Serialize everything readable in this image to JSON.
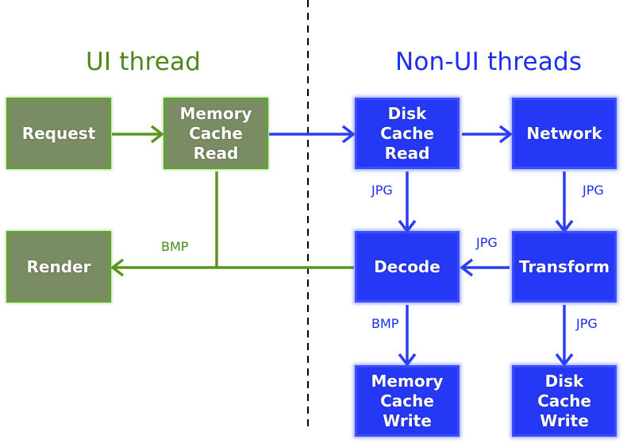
{
  "colors": {
    "ui_thread": "#4a8a1a",
    "non_ui_thread": "#1a2ff0",
    "green_box_fill": "#7a8c63",
    "blue_box_fill": "#2538f5",
    "divider": "#000000"
  },
  "sections": {
    "ui_thread": "UI thread",
    "non_ui_threads": "Non-UI threads"
  },
  "nodes": {
    "request": "Request",
    "memory_cache_read": "Memory\nCache\nRead",
    "render": "Render",
    "disk_cache_read": "Disk\nCache\nRead",
    "network": "Network",
    "decode": "Decode",
    "transform": "Transform",
    "memory_cache_write": "Memory\nCache\nWrite",
    "disk_cache_write": "Disk\nCache\nWrite"
  },
  "edge_labels": {
    "memory_read_to_render": "BMP",
    "disk_read_to_decode": "JPG",
    "network_to_transform": "JPG",
    "transform_to_decode": "JPG",
    "decode_to_memory_write": "BMP",
    "transform_to_disk_write": "JPG"
  },
  "edges": [
    {
      "from": "request",
      "to": "memory_cache_read",
      "color": "green"
    },
    {
      "from": "memory_cache_read",
      "to": "disk_cache_read",
      "color": "blue"
    },
    {
      "from": "disk_cache_read",
      "to": "network",
      "color": "blue"
    },
    {
      "from": "disk_cache_read",
      "to": "decode",
      "color": "blue",
      "label": "JPG"
    },
    {
      "from": "network",
      "to": "transform",
      "color": "blue",
      "label": "JPG"
    },
    {
      "from": "transform",
      "to": "decode",
      "color": "blue",
      "label": "JPG"
    },
    {
      "from": "decode",
      "to": "memory_cache_write",
      "color": "blue",
      "label": "BMP"
    },
    {
      "from": "transform",
      "to": "disk_cache_write",
      "color": "blue",
      "label": "JPG"
    },
    {
      "from": "decode",
      "to": "render",
      "color": "green"
    },
    {
      "from": "memory_cache_read",
      "to": "render",
      "color": "green",
      "label": "BMP"
    }
  ]
}
